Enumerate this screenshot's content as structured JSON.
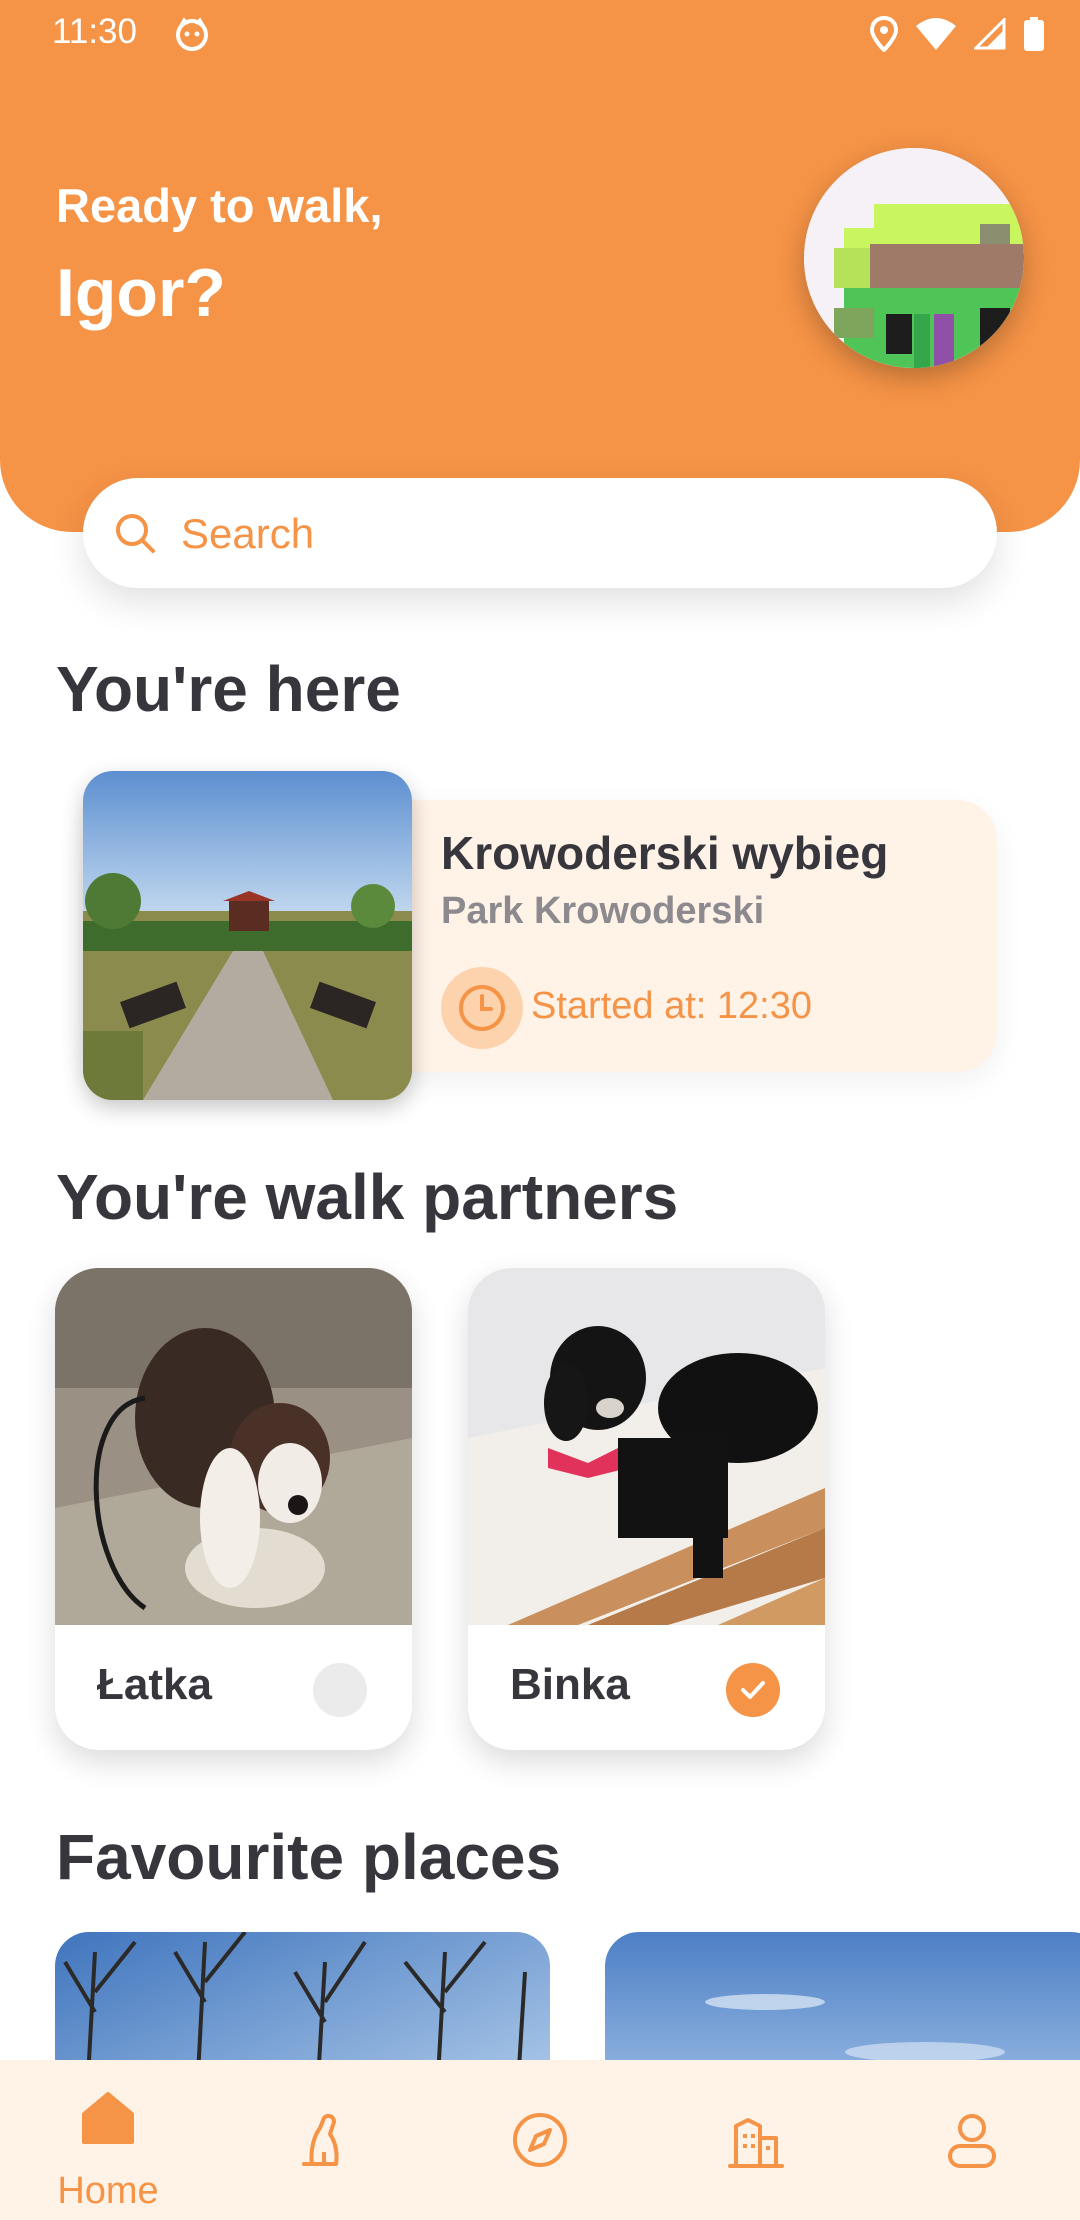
{
  "status_bar": {
    "time": "11:30"
  },
  "header": {
    "greeting": "Ready to walk,",
    "username": "Igor?"
  },
  "search": {
    "placeholder": "Search",
    "value": ""
  },
  "current_location": {
    "section_title": "You're here",
    "place_name": "Krowoderski wybieg",
    "park_name": "Park Krowoderski",
    "started_label": "Started at: 12:30"
  },
  "walk_partners": {
    "section_title": "You're walk partners",
    "dogs": [
      {
        "name": "Łatka",
        "selected": false
      },
      {
        "name": "Binka",
        "selected": true
      }
    ]
  },
  "favourite_places": {
    "section_title": "Favourite places"
  },
  "bottom_nav": {
    "items": [
      {
        "label": "Home",
        "icon": "home-icon",
        "active": true
      },
      {
        "label": "",
        "icon": "dog-icon",
        "active": false
      },
      {
        "label": "",
        "icon": "compass-icon",
        "active": false
      },
      {
        "label": "",
        "icon": "buildings-icon",
        "active": false
      },
      {
        "label": "",
        "icon": "profile-icon",
        "active": false
      }
    ]
  },
  "colors": {
    "accent": "#f59346",
    "card_background": "#fff2e7",
    "text_dark": "#38363d",
    "text_muted": "#8c8a8e"
  }
}
